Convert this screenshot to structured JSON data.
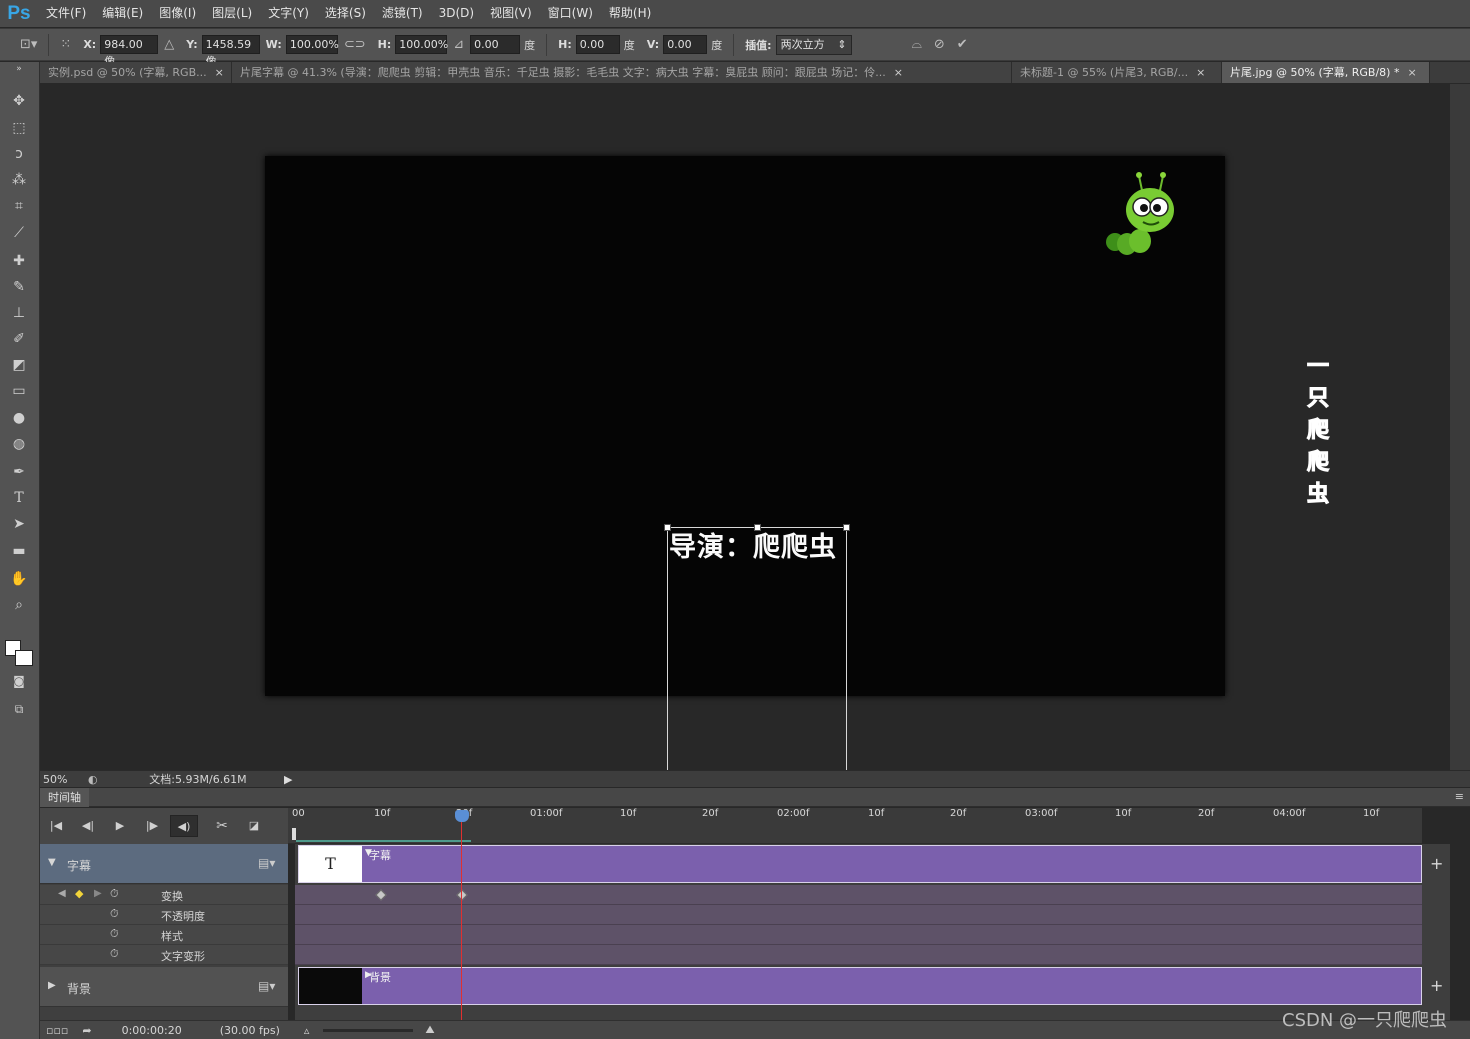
{
  "app": {
    "logo": "Ps"
  },
  "menu": [
    "文件(F)",
    "编辑(E)",
    "图像(I)",
    "图层(L)",
    "文字(Y)",
    "选择(S)",
    "滤镜(T)",
    "3D(D)",
    "视图(V)",
    "窗口(W)",
    "帮助(H)"
  ],
  "options": {
    "x_label": "X:",
    "x_value": "984.00 像",
    "y_label": "Y:",
    "y_value": "1458.59 像",
    "w_label": "W:",
    "w_value": "100.00%",
    "h_label": "H:",
    "h_value": "100.00%",
    "angle_value": "0.00",
    "deg": "度",
    "hskew_label": "H:",
    "hskew_value": "0.00",
    "vskew_label": "V:",
    "vskew_value": "0.00",
    "interp_label": "插值:",
    "interp_value": "两次立方"
  },
  "tabs": [
    {
      "label": "实例.psd @ 50% (字幕, RGB...",
      "active": false
    },
    {
      "label": "片尾字幕 @ 41.3% (导演：爬爬虫    剪辑：甲壳虫 音乐：千足虫 摄影：毛毛虫 文字：病大虫 字幕：臭屁虫 顾问：跟屁虫 场记：伶...",
      "active": false
    },
    {
      "label": "未标题-1 @ 55% (片尾3, RGB/...",
      "active": false
    },
    {
      "label": "片尾.jpg @ 50% (字幕, RGB/8) *",
      "active": true
    }
  ],
  "canvas": {
    "subtitle": "导演：爬爬虫",
    "logo_text": "一只爬爬虫"
  },
  "status": {
    "zoom": "50%",
    "doc": "文档:5.93M/6.61M"
  },
  "timeline": {
    "title": "时间轴",
    "ticks": [
      "00",
      "10f",
      "20f",
      "01:00f",
      "10f",
      "20f",
      "02:00f",
      "10f",
      "20f",
      "03:00f",
      "10f",
      "20f",
      "04:00f",
      "10f"
    ],
    "layers": [
      {
        "name": "字幕",
        "clip": "字幕",
        "thumb": "T"
      },
      {
        "name": "背景",
        "clip": "背景"
      }
    ],
    "props": [
      "变换",
      "不透明度",
      "样式",
      "文字变形"
    ],
    "timecode": "0:00:00:20",
    "fps": "(30.00 fps)"
  },
  "watermark": "CSDN @一只爬爬虫"
}
